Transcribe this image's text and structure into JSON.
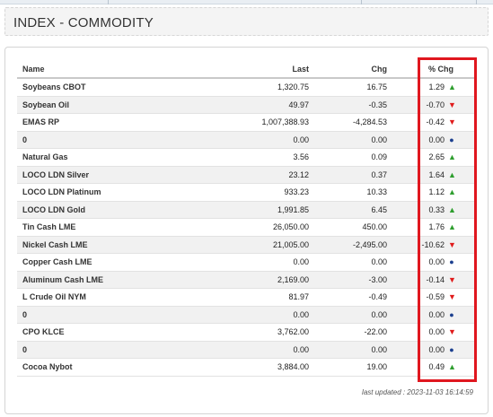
{
  "header": {
    "title": "INDEX - COMMODITY"
  },
  "table": {
    "columns": {
      "name": "Name",
      "last": "Last",
      "chg": "Chg",
      "pct": "% Chg"
    },
    "rows": [
      {
        "name": "Soybeans CBOT",
        "last": "1,320.75",
        "chg": "16.75",
        "pct": "1.29",
        "dir": "up"
      },
      {
        "name": "Soybean Oil",
        "last": "49.97",
        "chg": "-0.35",
        "pct": "-0.70",
        "dir": "down"
      },
      {
        "name": "EMAS RP",
        "last": "1,007,388.93",
        "chg": "-4,284.53",
        "pct": "-0.42",
        "dir": "down"
      },
      {
        "name": "0",
        "last": "0.00",
        "chg": "0.00",
        "pct": "0.00",
        "dir": "flat"
      },
      {
        "name": "Natural Gas",
        "last": "3.56",
        "chg": "0.09",
        "pct": "2.65",
        "dir": "up"
      },
      {
        "name": "LOCO LDN Silver",
        "last": "23.12",
        "chg": "0.37",
        "pct": "1.64",
        "dir": "up"
      },
      {
        "name": "LOCO LDN Platinum",
        "last": "933.23",
        "chg": "10.33",
        "pct": "1.12",
        "dir": "up"
      },
      {
        "name": "LOCO LDN Gold",
        "last": "1,991.85",
        "chg": "6.45",
        "pct": "0.33",
        "dir": "up"
      },
      {
        "name": "Tin Cash LME",
        "last": "26,050.00",
        "chg": "450.00",
        "pct": "1.76",
        "dir": "up"
      },
      {
        "name": "Nickel Cash LME",
        "last": "21,005.00",
        "chg": "-2,495.00",
        "pct": "-10.62",
        "dir": "down"
      },
      {
        "name": "Copper Cash LME",
        "last": "0.00",
        "chg": "0.00",
        "pct": "0.00",
        "dir": "flat"
      },
      {
        "name": "Aluminum Cash LME",
        "last": "2,169.00",
        "chg": "-3.00",
        "pct": "-0.14",
        "dir": "down"
      },
      {
        "name": "L Crude Oil NYM",
        "last": "81.97",
        "chg": "-0.49",
        "pct": "-0.59",
        "dir": "down"
      },
      {
        "name": "0",
        "last": "0.00",
        "chg": "0.00",
        "pct": "0.00",
        "dir": "flat"
      },
      {
        "name": "CPO KLCE",
        "last": "3,762.00",
        "chg": "-22.00",
        "pct": "0.00",
        "dir": "down"
      },
      {
        "name": "0",
        "last": "0.00",
        "chg": "0.00",
        "pct": "0.00",
        "dir": "flat"
      },
      {
        "name": "Cocoa Nybot",
        "last": "3,884.00",
        "chg": "19.00",
        "pct": "0.49",
        "dir": "up"
      }
    ]
  },
  "indicators": {
    "up": "▲",
    "down": "▼",
    "flat": "●"
  },
  "colors": {
    "up": "#2e9e2e",
    "down": "#e01b1b",
    "flat": "#1b3f8f",
    "highlight": "#e0171f"
  },
  "footer": {
    "last_updated": "last updated : 2023-11-03 16:14:59"
  }
}
